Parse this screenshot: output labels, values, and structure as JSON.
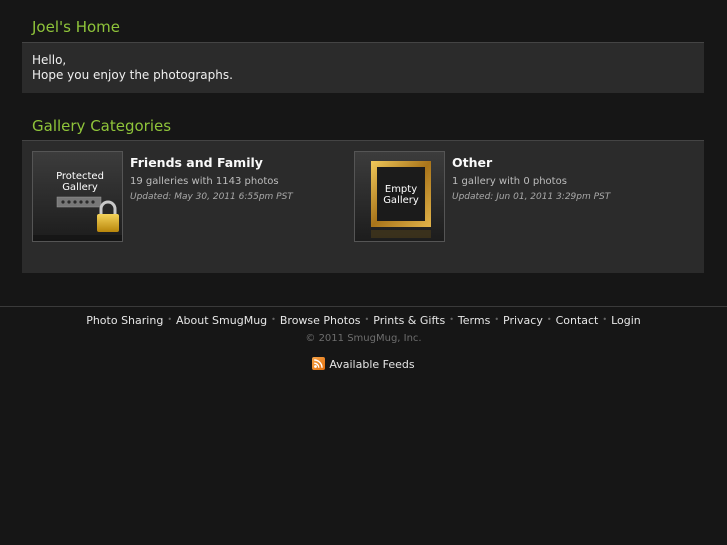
{
  "home": {
    "title": "Joel's Home",
    "welcome_line1": "Hello,",
    "welcome_line2": "Hope you enjoy the photographs."
  },
  "gallery": {
    "title": "Gallery Categories",
    "categories": [
      {
        "name": "Friends and Family",
        "count": "19 galleries with 1143 photos",
        "updated": "Updated: May 30, 2011 6:55pm PST",
        "thumb_line1": "Protected",
        "thumb_line2": "Gallery",
        "thumb_icon": "padlock-icon"
      },
      {
        "name": "Other",
        "count": "1 gallery with 0 photos",
        "updated": "Updated: Jun 01, 2011 3:29pm PST",
        "thumb_line1": "Empty",
        "thumb_line2": "Gallery",
        "thumb_icon": "gold-frame-icon"
      }
    ]
  },
  "footer": {
    "links": [
      "Photo Sharing",
      "About SmugMug",
      "Browse Photos",
      "Prints & Gifts",
      "Terms",
      "Privacy",
      "Contact",
      "Login"
    ],
    "copyright": "© 2011 SmugMug, Inc.",
    "feeds": "Available Feeds"
  },
  "colors": {
    "accent": "#8fc43a",
    "background": "#161616",
    "panel": "#2b2b2b"
  }
}
